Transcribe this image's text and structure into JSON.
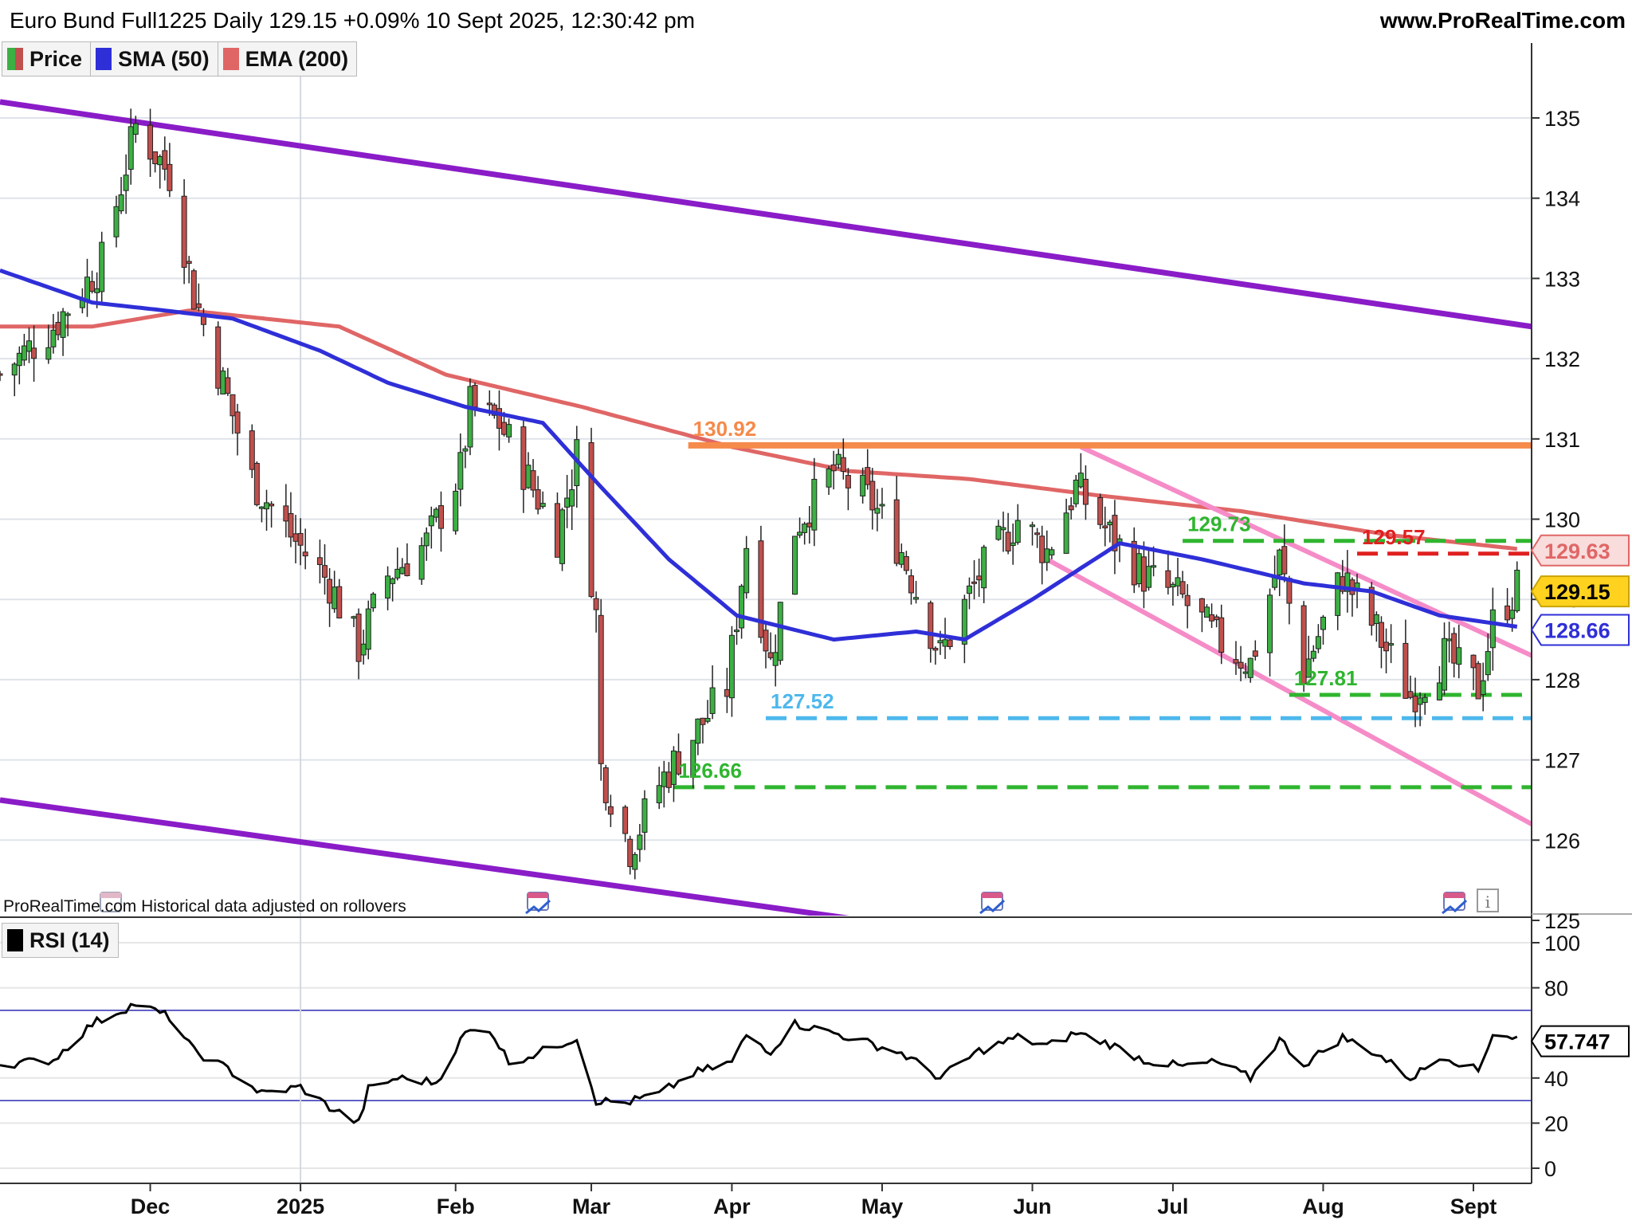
{
  "header": {
    "title": "Euro Bund Full1225 Daily 129.15 +0.09% 10 Sept 2025, 12:30:42 pm",
    "site": "www.ProRealTime.com"
  },
  "legend": {
    "items": [
      {
        "label": "Price",
        "color": "#3cb043"
      },
      {
        "label": "SMA (50)",
        "color": "#2f2fd8"
      },
      {
        "label": "EMA (200)",
        "color": "#e06666"
      }
    ]
  },
  "note": "ProRealTime.com  Historical data adjusted on rollovers",
  "rsi_legend": {
    "label": "RSI (14)",
    "color": "#000000"
  },
  "colors": {
    "up": "#3cb043",
    "down": "#c0504d",
    "sma": "#2f2fd8",
    "ema": "#e06666",
    "channel": "#8a1cc8",
    "pink": "#f58cc8",
    "resistance": "#f58a4b",
    "green_level": "#2fb52f",
    "blue_level": "#4db8ec",
    "red_level": "#e02020",
    "last_price_tag": "#ffd21f"
  },
  "chart_data": [
    {
      "type": "candlestick",
      "title": "Euro Bund Full1225 Daily",
      "y_ticks": [
        125,
        126,
        127,
        128,
        129,
        130,
        131,
        132,
        133,
        134,
        135
      ],
      "ylim": [
        124.8,
        135.9
      ],
      "x_month_labels": [
        "Dec",
        "2025",
        "Feb",
        "Mar",
        "Apr",
        "May",
        "Jun",
        "Jul",
        "Aug",
        "Sept"
      ],
      "months": [
        {
          "label": "Dec",
          "start": "2024-12-02"
        },
        {
          "label": "2025",
          "start": "2025-01-02"
        },
        {
          "label": "Feb",
          "start": "2025-02-03"
        },
        {
          "label": "Mar",
          "start": "2025-03-03"
        },
        {
          "label": "Apr",
          "start": "2025-04-01"
        },
        {
          "label": "May",
          "start": "2025-05-02"
        },
        {
          "label": "Jun",
          "start": "2025-06-02"
        },
        {
          "label": "Jul",
          "start": "2025-07-01"
        },
        {
          "label": "Aug",
          "start": "2025-08-01"
        },
        {
          "label": "Sept",
          "start": "2025-09-01"
        }
      ],
      "close_path": [
        [
          "2024-11-01",
          131.8
        ],
        [
          "2024-11-12",
          132.4
        ],
        [
          "2024-11-22",
          133.2
        ],
        [
          "2024-11-29",
          134.9
        ],
        [
          "2024-12-06",
          134.3
        ],
        [
          "2024-12-11",
          132.8
        ],
        [
          "2024-12-18",
          131.5
        ],
        [
          "2024-12-23",
          130.5
        ],
        [
          "2024-12-31",
          129.8
        ],
        [
          "2025-01-08",
          129.2
        ],
        [
          "2025-01-14",
          128.4
        ],
        [
          "2025-01-20",
          129.3
        ],
        [
          "2025-01-28",
          129.7
        ],
        [
          "2025-02-04",
          130.6
        ],
        [
          "2025-02-06",
          131.4
        ],
        [
          "2025-02-12",
          131.2
        ],
        [
          "2025-02-18",
          130.5
        ],
        [
          "2025-02-24",
          129.8
        ],
        [
          "2025-02-28",
          130.8
        ],
        [
          "2025-03-04",
          128.8
        ],
        [
          "2025-03-05",
          126.9
        ],
        [
          "2025-03-11",
          125.9
        ],
        [
          "2025-03-17",
          126.7
        ],
        [
          "2025-03-24",
          127.3
        ],
        [
          "2025-03-31",
          127.9
        ],
        [
          "2025-04-04",
          129.7
        ],
        [
          "2025-04-09",
          128.2
        ],
        [
          "2025-04-14",
          129.9
        ],
        [
          "2025-04-22",
          130.6
        ],
        [
          "2025-04-30",
          130.2
        ],
        [
          "2025-05-06",
          129.6
        ],
        [
          "2025-05-14",
          128.3
        ],
        [
          "2025-05-22",
          129.3
        ],
        [
          "2025-05-30",
          130.0
        ],
        [
          "2025-06-05",
          129.6
        ],
        [
          "2025-06-11",
          130.4
        ],
        [
          "2025-06-18",
          129.8
        ],
        [
          "2025-06-25",
          129.3
        ],
        [
          "2025-07-03",
          129.0
        ],
        [
          "2025-07-10",
          128.5
        ],
        [
          "2025-07-17",
          128.2
        ],
        [
          "2025-07-23",
          129.5
        ],
        [
          "2025-07-28",
          128.1
        ],
        [
          "2025-08-05",
          129.3
        ],
        [
          "2025-08-12",
          128.6
        ],
        [
          "2025-08-19",
          127.8
        ],
        [
          "2025-08-26",
          128.3
        ],
        [
          "2025-09-02",
          127.9
        ],
        [
          "2025-09-05",
          128.7
        ],
        [
          "2025-09-10",
          129.15
        ]
      ],
      "sma_50": [
        [
          "2024-11-01",
          133.1
        ],
        [
          "2024-11-20",
          132.7
        ],
        [
          "2024-12-05",
          132.6
        ],
        [
          "2024-12-19",
          132.5
        ],
        [
          "2025-01-06",
          132.1
        ],
        [
          "2025-01-20",
          131.7
        ],
        [
          "2025-02-05",
          131.4
        ],
        [
          "2025-02-21",
          131.2
        ],
        [
          "2025-03-05",
          130.4
        ],
        [
          "2025-03-19",
          129.5
        ],
        [
          "2025-04-02",
          128.8
        ],
        [
          "2025-04-22",
          128.5
        ],
        [
          "2025-05-09",
          128.6
        ],
        [
          "2025-05-19",
          128.5
        ],
        [
          "2025-06-02",
          129.0
        ],
        [
          "2025-06-20",
          129.7
        ],
        [
          "2025-07-07",
          129.5
        ],
        [
          "2025-07-28",
          129.2
        ],
        [
          "2025-08-11",
          129.1
        ],
        [
          "2025-08-25",
          128.8
        ],
        [
          "2025-09-10",
          128.66
        ]
      ],
      "ema_200": [
        [
          "2024-11-01",
          132.4
        ],
        [
          "2024-11-20",
          132.4
        ],
        [
          "2024-12-10",
          132.6
        ],
        [
          "2025-01-10",
          132.4
        ],
        [
          "2025-02-01",
          131.8
        ],
        [
          "2025-03-01",
          131.4
        ],
        [
          "2025-04-01",
          130.9
        ],
        [
          "2025-04-25",
          130.6
        ],
        [
          "2025-05-20",
          130.5
        ],
        [
          "2025-06-15",
          130.3
        ],
        [
          "2025-07-15",
          130.1
        ],
        [
          "2025-08-15",
          129.8
        ],
        [
          "2025-09-10",
          129.63
        ]
      ],
      "trendlines": [
        {
          "name": "channel-top",
          "color": "#8a1cc8",
          "points": [
            [
              "2024-11-01",
              135.2
            ],
            [
              "2025-09-13",
              132.4
            ]
          ]
        },
        {
          "name": "channel-bottom",
          "color": "#8a1cc8",
          "points": [
            [
              "2024-11-01",
              126.5
            ],
            [
              "2025-05-22",
              124.8
            ]
          ]
        },
        {
          "name": "pink-upper",
          "color": "#f58cc8",
          "points": [
            [
              "2025-06-12",
              130.9
            ],
            [
              "2025-09-13",
              128.3
            ]
          ]
        },
        {
          "name": "pink-lower",
          "color": "#f58cc8",
          "points": [
            [
              "2025-06-05",
              129.5
            ],
            [
              "2025-09-13",
              126.2
            ]
          ]
        }
      ],
      "horizontal_levels": [
        {
          "value": 130.92,
          "label": "130.92",
          "color": "#f58a4b",
          "style": "solid",
          "from": "2025-03-23"
        },
        {
          "value": 129.73,
          "label": "129.73",
          "color": "#2fb52f",
          "style": "dashed",
          "from": "2025-07-03"
        },
        {
          "value": 129.57,
          "label": "129.57",
          "color": "#e02020",
          "style": "dashed",
          "from": "2025-08-08"
        },
        {
          "value": 127.81,
          "label": "127.81",
          "color": "#2fb52f",
          "style": "dashed",
          "from": "2025-07-25"
        },
        {
          "value": 127.52,
          "label": "127.52",
          "color": "#4db8ec",
          "style": "dashed",
          "from": "2025-04-08"
        },
        {
          "value": 126.66,
          "label": "126.66",
          "color": "#2fb52f",
          "style": "dashed",
          "from": "2025-03-20"
        }
      ],
      "price_tags": [
        {
          "value": 129.63,
          "label": "129.63",
          "kind": "ema"
        },
        {
          "value": 129.15,
          "label": "129.15",
          "kind": "last"
        },
        {
          "value": 128.66,
          "label": "128.66",
          "kind": "sma"
        }
      ]
    },
    {
      "type": "line",
      "title": "RSI (14)",
      "y_ticks": [
        0,
        20,
        40,
        80,
        100
      ],
      "ylim": [
        0,
        100
      ],
      "bands": [
        30,
        70
      ],
      "series": [
        {
          "name": "RSI (14)",
          "points": [
            [
              "2024-11-01",
              46
            ],
            [
              "2024-11-12",
              48
            ],
            [
              "2024-11-20",
              64
            ],
            [
              "2024-11-29",
              73
            ],
            [
              "2024-12-06",
              67
            ],
            [
              "2024-12-11",
              52
            ],
            [
              "2024-12-18",
              44
            ],
            [
              "2024-12-25",
              33
            ],
            [
              "2025-01-02",
              36
            ],
            [
              "2025-01-08",
              27
            ],
            [
              "2025-01-14",
              20
            ],
            [
              "2025-01-16",
              35
            ],
            [
              "2025-01-22",
              40
            ],
            [
              "2025-01-30",
              38
            ],
            [
              "2025-02-05",
              60
            ],
            [
              "2025-02-10",
              62
            ],
            [
              "2025-02-14",
              47
            ],
            [
              "2025-02-20",
              51
            ],
            [
              "2025-02-28",
              58
            ],
            [
              "2025-03-04",
              30
            ],
            [
              "2025-03-10",
              29
            ],
            [
              "2025-03-17",
              33
            ],
            [
              "2025-03-24",
              42
            ],
            [
              "2025-04-01",
              47
            ],
            [
              "2025-04-04",
              59
            ],
            [
              "2025-04-09",
              52
            ],
            [
              "2025-04-14",
              64
            ],
            [
              "2025-04-22",
              60
            ],
            [
              "2025-04-30",
              55
            ],
            [
              "2025-05-06",
              51
            ],
            [
              "2025-05-14",
              40
            ],
            [
              "2025-05-22",
              52
            ],
            [
              "2025-05-30",
              58
            ],
            [
              "2025-06-05",
              54
            ],
            [
              "2025-06-11",
              60
            ],
            [
              "2025-06-18",
              55
            ],
            [
              "2025-06-25",
              48
            ],
            [
              "2025-07-03",
              45
            ],
            [
              "2025-07-10",
              47
            ],
            [
              "2025-07-17",
              40
            ],
            [
              "2025-07-23",
              57
            ],
            [
              "2025-07-28",
              46
            ],
            [
              "2025-08-05",
              58
            ],
            [
              "2025-08-12",
              51
            ],
            [
              "2025-08-19",
              40
            ],
            [
              "2025-08-26",
              50
            ],
            [
              "2025-09-02",
              43
            ],
            [
              "2025-09-05",
              60
            ],
            [
              "2025-09-10",
              57.747
            ]
          ]
        }
      ],
      "last_value_label": "57.747"
    }
  ]
}
